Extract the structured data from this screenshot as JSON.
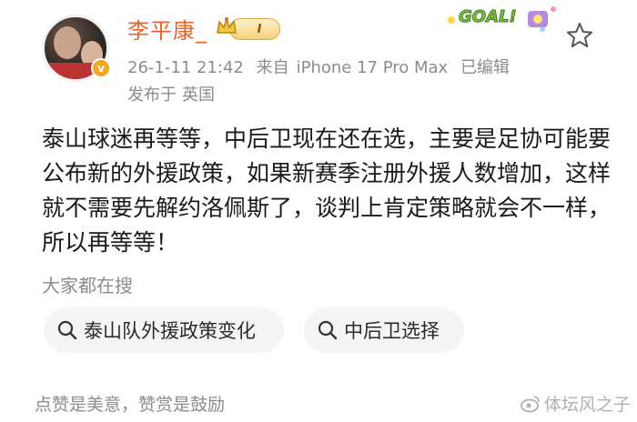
{
  "header": {
    "username": "李平康_",
    "level_badge": "I",
    "timestamp": "26-1-11 21:42",
    "source_prefix": "来自",
    "device": "iPhone 17 Pro Max",
    "edited": "已编辑",
    "location_prefix": "发布于",
    "location": "英国",
    "decor_text": "GOAL!"
  },
  "post": {
    "body": "泰山球迷再等等，中后卫现在还在选，主要是足协可能要公布新的外援政策，如果新赛季注册外援人数增加，这样就不需要先解约洛佩斯了，谈判上肯定策略就会不一样，所以再等等！"
  },
  "trending": {
    "title": "大家都在搜",
    "chips": [
      {
        "label": "泰山队外援政策变化"
      },
      {
        "label": "中后卫选择"
      }
    ]
  },
  "footer": {
    "text": "点赞是美意，赞赏是鼓励",
    "watermark": "体坛风之子"
  },
  "colors": {
    "username": "#e8622a",
    "meta": "#8c8c8c",
    "chip_bg": "#f5f5f5",
    "badge_gold": "#f5a623"
  },
  "icons": [
    "verified-v-icon",
    "crown-icon",
    "goal-decoration-icon",
    "star-outline-icon",
    "search-icon",
    "weibo-logo-icon"
  ]
}
